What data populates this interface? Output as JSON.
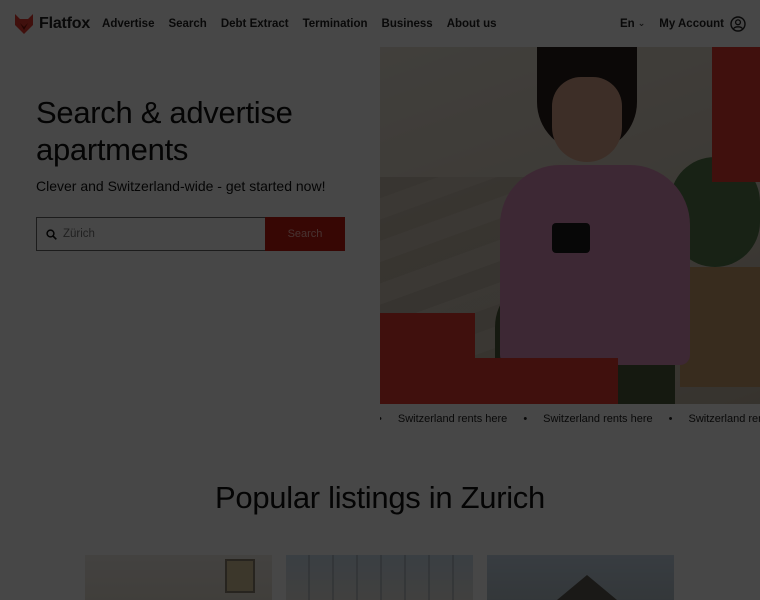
{
  "header": {
    "logo_text": "Flatfox",
    "nav": [
      "Advertise",
      "Search",
      "Debt Extract",
      "Termination",
      "Business",
      "About us"
    ],
    "language": "En",
    "account_label": "My Account"
  },
  "hero": {
    "title_line1": "Search & advertise",
    "title_line2": "apartments",
    "subtitle": "Clever and Switzerland-wide - get started now!",
    "search_placeholder": "Zürich",
    "search_button": "Search"
  },
  "ticker": {
    "items": [
      "Switzerland rents here",
      "Switzerland rents here",
      "Switzerland rents here"
    ],
    "separator": "•"
  },
  "popular": {
    "title": "Popular listings in Zurich"
  },
  "colors": {
    "brand_red": "#e63a2f",
    "button_red": "#c41911"
  }
}
